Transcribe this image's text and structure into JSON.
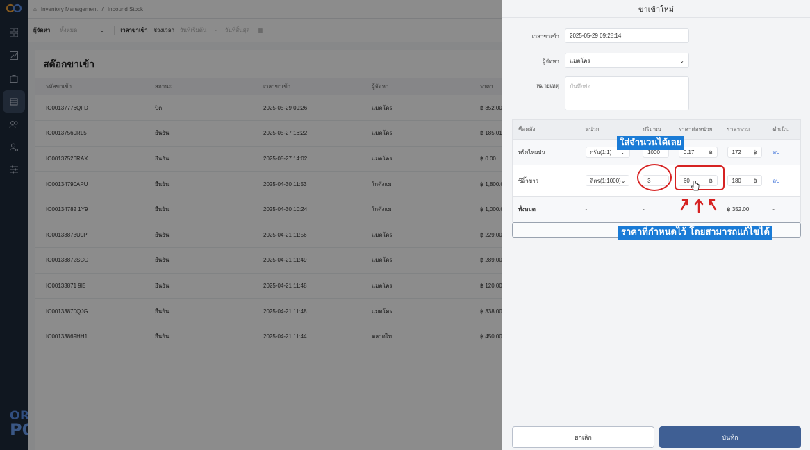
{
  "sidebar": {
    "icons": [
      "grid-icon",
      "chart-icon",
      "bag-icon",
      "inventory-icon",
      "users-icon",
      "user-settings-icon",
      "sliders-icon"
    ],
    "brand_line1": "ORDER",
    "brand_line2": "POS"
  },
  "breadcrumb": {
    "section": "Inventory Management",
    "page": "Inbound Stock"
  },
  "filters": {
    "supplier_label": "ผู้จัดหา",
    "supplier_value": "ทั้งหมด",
    "time_label": "เวลาขาเข้า",
    "range_label": "ช่วงเวลา",
    "start_placeholder": "วันที่เริ่มต้น",
    "dash": "-",
    "end_placeholder": "วันที่สิ้นสุด"
  },
  "list": {
    "title": "สต๊อกขาเข้า",
    "columns": [
      "รหัสขาเข้า",
      "สถานะ",
      "เวลาขาเข้า",
      "ผู้จัดหา",
      "ราคา"
    ],
    "rows": [
      {
        "id": "IO00137776QFD",
        "status": "ปิด",
        "status_type": "cancel",
        "time": "2025-05-29 09:26",
        "supplier": "แมคโคร",
        "price": "฿ 352.00"
      },
      {
        "id": "IO00137560RL5",
        "status": "ยืนยัน",
        "status_type": "ok",
        "time": "2025-05-27 16:22",
        "supplier": "แมคโคร",
        "price": "฿ 185.01"
      },
      {
        "id": "IO00137526RAX",
        "status": "ยืนยัน",
        "status_type": "ok",
        "time": "2025-05-27 14:02",
        "supplier": "แมคโคร",
        "price": "฿ 0.00"
      },
      {
        "id": "IO00134790APU",
        "status": "ยืนยัน",
        "status_type": "ok",
        "time": "2025-04-30 11:53",
        "supplier": "โกดังแม",
        "price": "฿ 1,800.00"
      },
      {
        "id": "IO00134782 1Y9",
        "status": "ยืนยัน",
        "status_type": "ok",
        "time": "2025-04-30 10:24",
        "supplier": "โกดังแม",
        "price": "฿ 1,000.00"
      },
      {
        "id": "IO00133873U9P",
        "status": "ยืนยัน",
        "status_type": "ok",
        "time": "2025-04-21 11:56",
        "supplier": "แมคโคร",
        "price": "฿ 229.00"
      },
      {
        "id": "IO00133872SCO",
        "status": "ยืนยัน",
        "status_type": "ok",
        "time": "2025-04-21 11:49",
        "supplier": "แมคโคร",
        "price": "฿ 289.00"
      },
      {
        "id": "IO00133871 9I5",
        "status": "ยืนยัน",
        "status_type": "ok",
        "time": "2025-04-21 11:48",
        "supplier": "แมคโคร",
        "price": "฿ 120.00"
      },
      {
        "id": "IO00133870QJG",
        "status": "ยืนยัน",
        "status_type": "ok",
        "time": "2025-04-21 11:48",
        "supplier": "แมคโคร",
        "price": "฿ 338.00"
      },
      {
        "id": "IO00133869HH1",
        "status": "ยืนยัน",
        "status_type": "ok",
        "time": "2025-04-21 11:44",
        "supplier": "ตลาดไท",
        "price": "฿ 450.00"
      }
    ]
  },
  "drawer": {
    "title": "ขาเข้าใหม่",
    "time_label": "เวลาขาเข้า",
    "time_value": "2025-05-29 09:28:14",
    "supplier_label": "ผู้จัดหา",
    "supplier_value": "แมคโคร",
    "note_label": "หมายเหตุ",
    "note_placeholder": "บันทึกย่อ",
    "item_columns": [
      "ชื่อคลัง",
      "หน่วย",
      "ปริมาณ",
      "ราคาต่อหน่วย",
      "ราคารวม",
      "ดำเนิน"
    ],
    "items": [
      {
        "name": "พริกไทยป่น",
        "unit": "กรัม(1:1)",
        "qty": "1000",
        "unit_price": "0.17",
        "total": "172",
        "currency": "฿",
        "action": "ลบ"
      },
      {
        "name": "ซีอิ๊วขาว",
        "unit": "ลิตร(1:1000)",
        "qty": "3",
        "unit_price": "60",
        "total": "180",
        "currency": "฿",
        "action": "ลบ"
      }
    ],
    "total_row": {
      "label": "ทั้งหมด",
      "unit": "-",
      "qty": "-",
      "total": "฿ 352.00",
      "action": "-"
    },
    "cancel_label": "ยกเลิก",
    "save_label": "บันทึก"
  },
  "annotations": {
    "qty_hint": "ใส่จำนวนได้เลย",
    "price_hint": "ราคาที่กำหนดไว้ โดยสามารถแก้ไขได้",
    "hint_color": "#1a7bd6",
    "mark_color": "#d62222"
  }
}
